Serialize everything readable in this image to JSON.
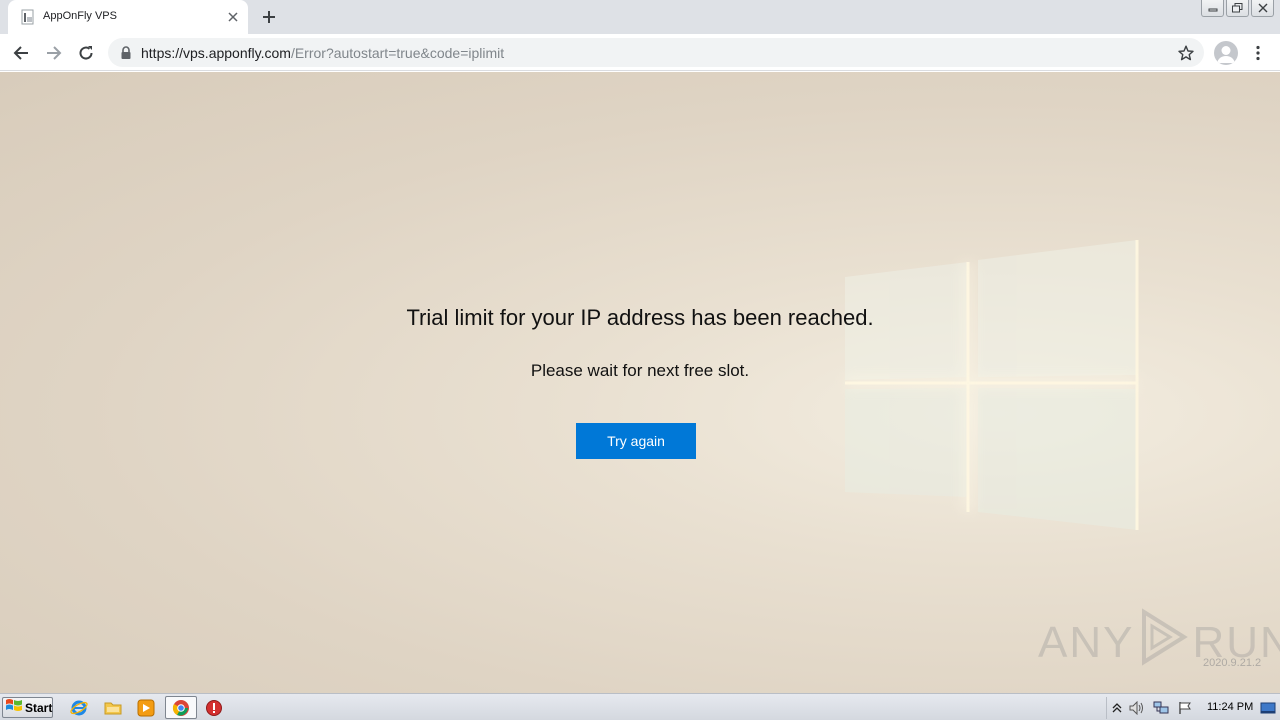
{
  "browser": {
    "tab": {
      "title": "AppOnFly VPS"
    },
    "address": {
      "host": "https://vps.apponfly.com",
      "path": "/Error?autostart=true&code=iplimit"
    },
    "icons": [
      "favicon-page-icon",
      "close-icon",
      "plus-icon",
      "back-arrow-icon",
      "forward-arrow-icon",
      "reload-icon",
      "lock-icon",
      "star-icon",
      "profile-icon",
      "kebab-menu-icon",
      "minimize-icon",
      "restore-icon",
      "window-close-icon"
    ]
  },
  "page": {
    "title": "Trial limit for your IP address has been reached.",
    "subtitle": "Please wait for next free slot.",
    "button_label": "Try again",
    "button_color": "#0078d7"
  },
  "watermark": {
    "brand_left": "ANY",
    "brand_right": "RUN",
    "version": "2020.9.21.2"
  },
  "taskbar": {
    "start_label": "Start",
    "clock": "11:24 PM",
    "icons": [
      "windows-flag-icon",
      "internet-explorer-icon",
      "folder-icon",
      "media-player-icon",
      "chrome-icon",
      "stop-sign-icon",
      "tray-arrow-icon",
      "volume-icon",
      "network-icon",
      "action-center-flag-icon",
      "show-desktop-icon"
    ]
  }
}
